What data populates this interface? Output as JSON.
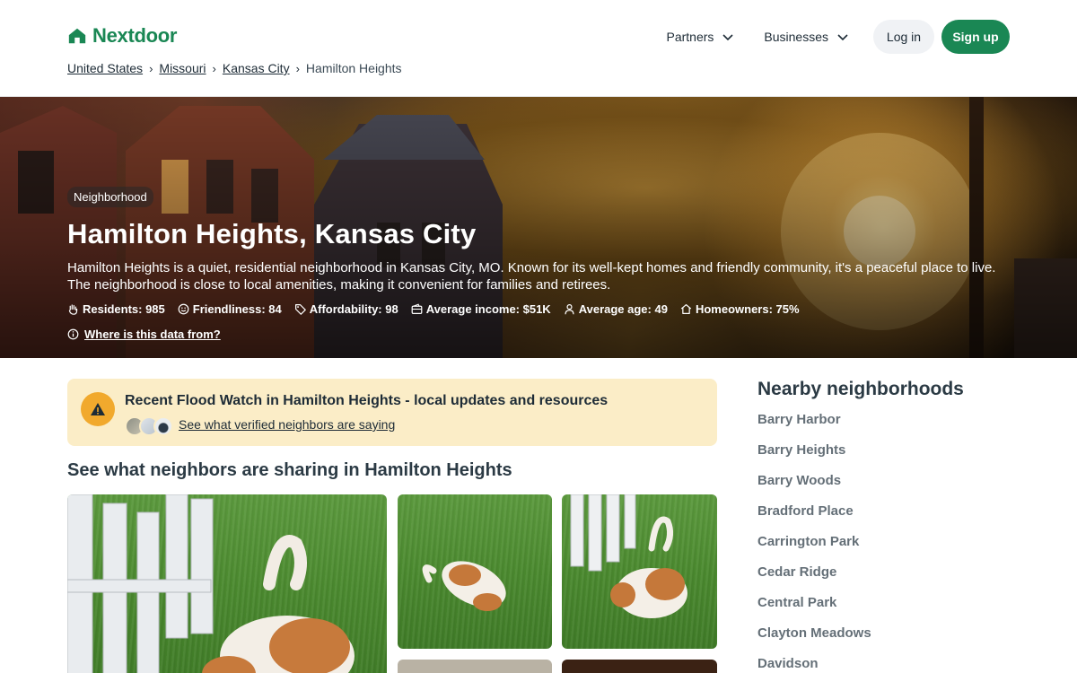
{
  "brand": {
    "name": "Nextdoor",
    "color": "#1a8754"
  },
  "nav": {
    "partners": "Partners",
    "businesses": "Businesses",
    "login": "Log in",
    "signup": "Sign up"
  },
  "breadcrumb": {
    "items": [
      "United States",
      "Missouri",
      "Kansas City"
    ],
    "current": "Hamilton Heights"
  },
  "hero": {
    "badge": "Neighborhood",
    "title": "Hamilton Heights, Kansas City",
    "description": "Hamilton Heights is a quiet, residential neighborhood in Kansas City, MO. Known for its well-kept homes and friendly community, it's a peaceful place to live. The neighborhood is close to local amenities, making it convenient for families and retirees.",
    "stats": {
      "residents": "Residents: 985",
      "friendliness": "Friendliness: 84",
      "affordability": "Affordability: 98",
      "income": "Average income: $51K",
      "age": "Average age: 49",
      "homeowners": "Homeowners: 75%"
    },
    "data_source": "Where is this data from?"
  },
  "alert": {
    "title": "Recent Flood Watch in Hamilton Heights - local updates and resources",
    "link": "See what verified neighbors are saying",
    "accent": "#f1a92d"
  },
  "section_title": "See what neighbors are sharing in Hamilton Heights",
  "sidebar": {
    "title": "Nearby neighborhoods",
    "items": [
      "Barry Harbor",
      "Barry Heights",
      "Barry Woods",
      "Bradford Place",
      "Carrington Park",
      "Cedar Ridge",
      "Central Park",
      "Clayton Meadows",
      "Davidson"
    ]
  }
}
